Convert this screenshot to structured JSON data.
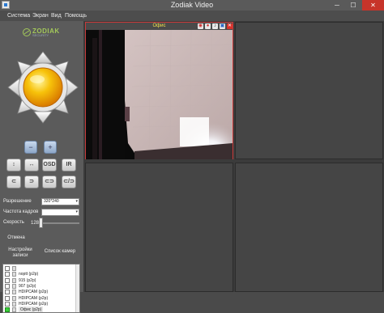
{
  "window": {
    "title": "Zodiak Video"
  },
  "menu": [
    "Система",
    "Экран",
    "Вид",
    "Помощь"
  ],
  "logo": {
    "text": "ZODIAK",
    "subtitle": "SECURITY"
  },
  "form": {
    "resolution_label": "Разрешение",
    "resolution_value": "320*240",
    "framerate_label": "Частота кадров",
    "framerate_value": "",
    "speed_label": "Скорость",
    "speed_value": "128"
  },
  "links": {
    "cancel": "Отмена",
    "settings": "Настройки записи",
    "camera_list": "Список камер"
  },
  "control_buttons": [
    "↕",
    "↔",
    "OSD",
    "IR",
    "⊂",
    "⊃",
    "⊂⊃",
    "⊂/⊃"
  ],
  "cameras": [
    {
      "label": "",
      "selected": false
    },
    {
      "label": "noptt (p2p)",
      "selected": false
    },
    {
      "label": "915 (p2p)",
      "selected": false
    },
    {
      "label": "907 (p2p)",
      "selected": false
    },
    {
      "label": "HDIPCAM (p2p)",
      "selected": false
    },
    {
      "label": "HDIPCAM (p2p)",
      "selected": false
    },
    {
      "label": "HDIPCAM (p2p)",
      "selected": false
    },
    {
      "label": "Офис (p2p)",
      "selected": true
    }
  ],
  "video": {
    "active_camera": "Офис"
  },
  "colors": {
    "accent_red": "#c83a3a",
    "camera_label": "#f2e24a",
    "joystick": "#f5a800"
  }
}
